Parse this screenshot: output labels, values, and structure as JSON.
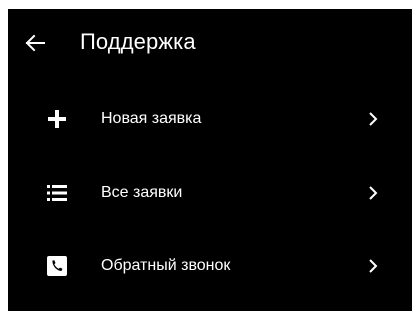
{
  "header": {
    "title": "Поддержка",
    "back_icon": "arrow-left-icon"
  },
  "menu": {
    "items": [
      {
        "label": "Новая заявка",
        "icon": "plus-icon"
      },
      {
        "label": "Все заявки",
        "icon": "list-icon"
      },
      {
        "label": "Обратный звонок",
        "icon": "phone-icon"
      }
    ]
  },
  "colors": {
    "background": "#000000",
    "text": "#ffffff",
    "frame": "#ffffff"
  }
}
